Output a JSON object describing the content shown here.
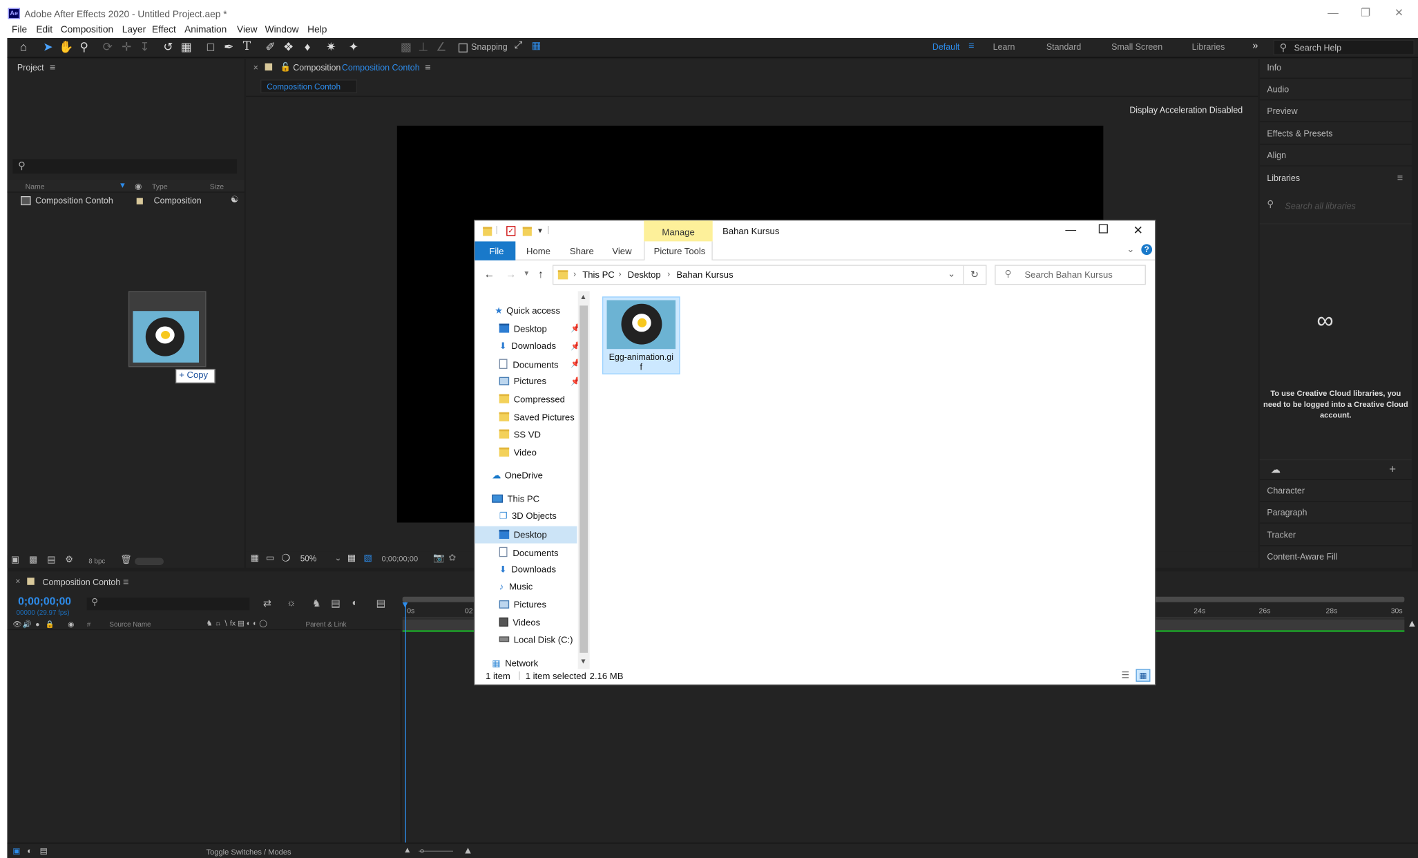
{
  "window": {
    "title": "Adobe After Effects 2020 - Untitled Project.aep *",
    "logo": "Ae",
    "controls": [
      "minimize-icon",
      "restore-icon",
      "close-icon"
    ]
  },
  "menu": [
    "File",
    "Edit",
    "Composition",
    "Layer",
    "Effect",
    "Animation",
    "View",
    "Window",
    "Help"
  ],
  "toolbar": {
    "snapping_label": "Snapping",
    "workspaces": [
      "Default",
      "Learn",
      "Standard",
      "Small Screen",
      "Libraries"
    ],
    "active_workspace": "Default",
    "search_help_placeholder": "Search Help"
  },
  "project_panel": {
    "title": "Project",
    "columns": [
      "Name",
      "Type",
      "Size"
    ],
    "items": [
      {
        "name": "Composition Contoh",
        "type": "Composition"
      }
    ],
    "bpc": "8 bpc",
    "drag_badge": "+ Copy"
  },
  "composition_panel": {
    "tab_prefix": "Composition",
    "tab_name": "Composition Contoh",
    "breadcrumb": "Composition Contoh",
    "notice": "Display Acceleration Disabled",
    "zoom": "50%",
    "timecode": "0;00;00;00"
  },
  "right_panel": {
    "items_top": [
      "Info",
      "Audio",
      "Preview",
      "Effects & Presets",
      "Align",
      "Libraries"
    ],
    "libraries_search_placeholder": "Search all libraries",
    "libraries_message": "To use Creative Cloud libraries, you need to be logged into a Creative Cloud account.",
    "items_bottom": [
      "Character",
      "Paragraph",
      "Tracker",
      "Content-Aware Fill"
    ]
  },
  "timeline": {
    "tab_name": "Composition Contoh",
    "timecode": "0;00;00;00",
    "fps": "00000 (29.97 fps)",
    "columns": [
      "Source Name",
      "Parent & Link"
    ],
    "ruler_labels": [
      "0s",
      "02",
      "24s",
      "26s",
      "28s",
      "30s"
    ],
    "footer_toggle": "Toggle Switches / Modes"
  },
  "explorer": {
    "ribbon_context": "Manage",
    "window_title": "Bahan Kursus",
    "tabs": [
      "File",
      "Home",
      "Share",
      "View"
    ],
    "context_tab": "Picture Tools",
    "breadcrumb": [
      "This PC",
      "Desktop",
      "Bahan Kursus"
    ],
    "search_placeholder": "Search Bahan Kursus",
    "nav": {
      "quick_access": "Quick access",
      "quick_items": [
        "Desktop",
        "Downloads",
        "Documents",
        "Pictures",
        "Compressed",
        "Saved Pictures",
        "SS VD",
        "Video"
      ],
      "onedrive": "OneDrive",
      "this_pc": "This PC",
      "pc_items": [
        "3D Objects",
        "Desktop",
        "Documents",
        "Downloads",
        "Music",
        "Pictures",
        "Videos",
        "Local Disk (C:)"
      ],
      "network": "Network",
      "selected": "Desktop"
    },
    "file": {
      "name_line1": "Egg-animation.gi",
      "name_line2": "f"
    },
    "status": {
      "count": "1 item",
      "selected": "1 item selected",
      "size": "2.16 MB"
    }
  }
}
